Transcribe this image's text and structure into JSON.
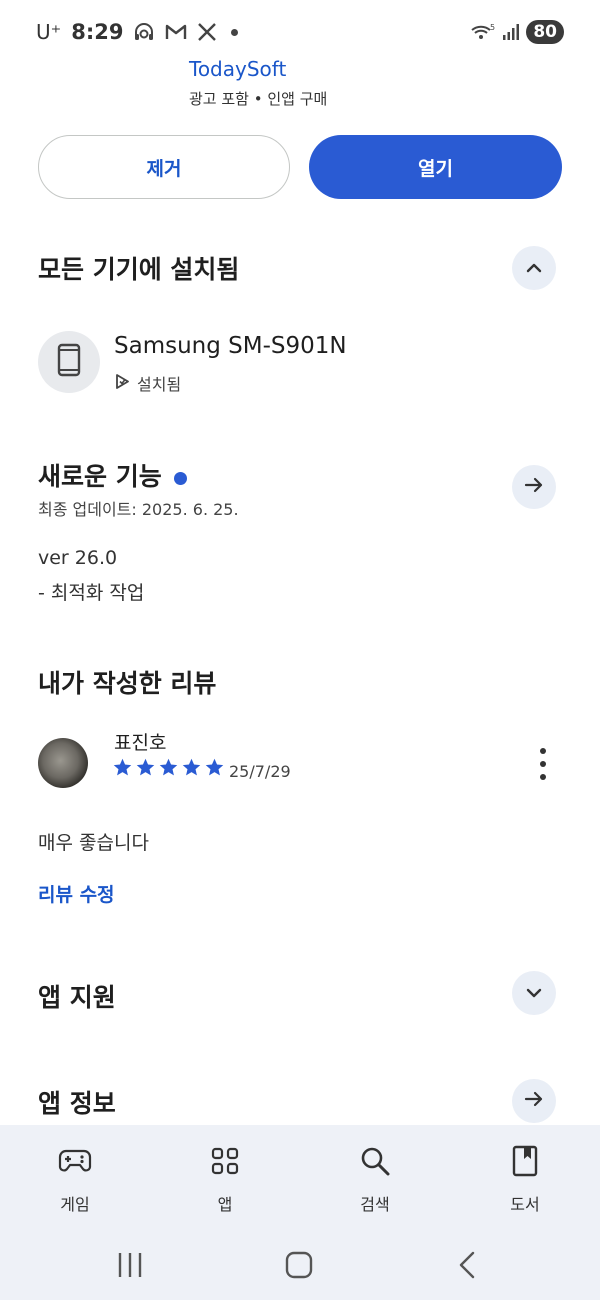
{
  "status_bar": {
    "carrier": "U⁺",
    "time": "8:29",
    "battery": "80"
  },
  "app": {
    "developer": "TodaySoft",
    "tags": "광고 포함 • 인앱 구매"
  },
  "actions": {
    "remove_label": "제거",
    "open_label": "열기"
  },
  "installed_section": {
    "title": "모든 기기에 설치됨",
    "device_name": "Samsung SM-S901N",
    "device_status": "설치됨"
  },
  "whats_new": {
    "title": "새로운 기능",
    "last_updated": "최종 업데이트: 2025. 6. 25.",
    "version": "ver 26.0",
    "change": "- 최적화 작업"
  },
  "my_review": {
    "title": "내가 작성한 리뷰",
    "reviewer": "표진호",
    "rating": 5,
    "date": "25/7/29",
    "text": "매우 좋습니다",
    "edit_label": "리뷰 수정"
  },
  "app_support": {
    "title": "앱 지원"
  },
  "app_info": {
    "title": "앱 정보"
  },
  "bottom_nav": {
    "items": [
      {
        "label": "게임",
        "icon": "gamepad-icon"
      },
      {
        "label": "앱",
        "icon": "apps-grid-icon"
      },
      {
        "label": "검색",
        "icon": "search-icon"
      },
      {
        "label": "도서",
        "icon": "book-icon"
      }
    ]
  },
  "colors": {
    "accent": "#2a5bd3",
    "link": "#1a56c9",
    "nav_bg": "#eef1f7"
  }
}
